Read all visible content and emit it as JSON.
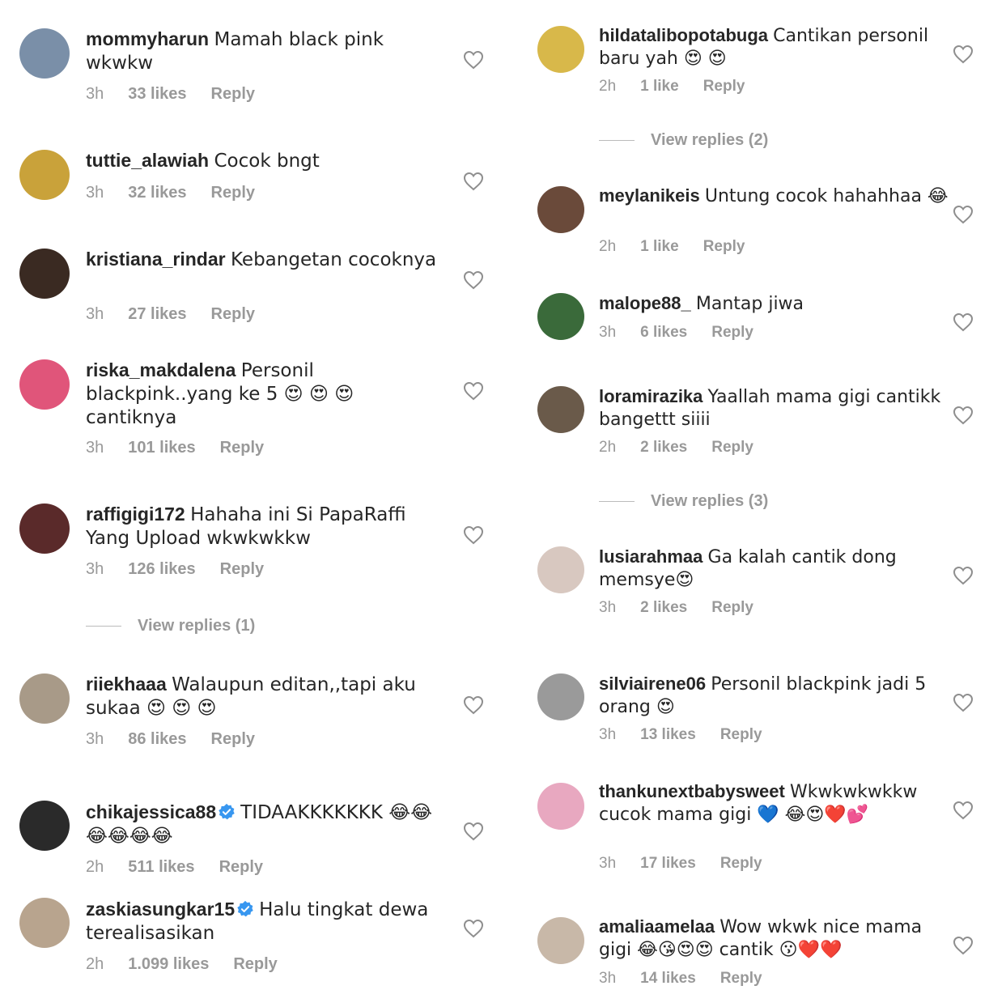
{
  "heart_color": "#8e8e8e",
  "meta_color": "#999999",
  "verified_color": "#3897f0",
  "left": [
    {
      "user": "mommyharun",
      "text": "Mamah black pink wkwkw",
      "time": "3h",
      "likes": "33 likes",
      "reply": "Reply",
      "avatar_color": "#7a8fa8"
    },
    {
      "user": "tuttie_alawiah",
      "text": "Cocok bngt",
      "time": "3h",
      "likes": "32 likes",
      "reply": "Reply",
      "avatar_color": "#c9a23a"
    },
    {
      "user": "kristiana_rindar",
      "text": "Kebangetan cocoknya",
      "time": "3h",
      "likes": "27 likes",
      "reply": "Reply",
      "avatar_color": "#3a2a22"
    },
    {
      "user": "riska_makdalena",
      "text": "Personil blackpink..yang ke 5 😍 😍 😍 cantiknya",
      "time": "3h",
      "likes": "101 likes",
      "reply": "Reply",
      "avatar_color": "#e0557a"
    },
    {
      "user": "raffigigi172",
      "text": "Hahaha ini Si PapaRaffi Yang Upload wkwkwkkw",
      "time": "3h",
      "likes": "126 likes",
      "reply": "Reply",
      "avatar_color": "#5a2a2a",
      "view_replies": "View replies (1)"
    },
    {
      "user": "riiekhaaa",
      "text": "Walaupun editan,,tapi aku sukaa 😍 😍 😍",
      "time": "3h",
      "likes": "86 likes",
      "reply": "Reply",
      "avatar_color": "#a89a88"
    },
    {
      "user": "chikajessica88",
      "text": "TIDAAKKKKKKK 😂😂😂😂😂😂",
      "time": "2h",
      "likes": "511 likes",
      "reply": "Reply",
      "avatar_color": "#2a2a2a",
      "verified": true
    },
    {
      "user": "zaskiasungkar15",
      "text": "Halu tingkat dewa terealisasikan",
      "time": "2h",
      "likes": "1.099 likes",
      "reply": "Reply",
      "avatar_color": "#b8a48e",
      "verified": true
    }
  ],
  "right": [
    {
      "user": "hildatalibopotabuga",
      "text": "Cantikan personil baru yah 😍 😍",
      "time": "2h",
      "likes": "1 like",
      "reply": "Reply",
      "avatar_color": "#d8b84a",
      "view_replies": "View replies (2)"
    },
    {
      "user": "meylanikeis",
      "text": "Untung cocok hahahhaa 😂",
      "time": "2h",
      "likes": "1 like",
      "reply": "Reply",
      "avatar_color": "#6a4a3a"
    },
    {
      "user": "malope88_",
      "text": "Mantap jiwa",
      "time": "3h",
      "likes": "6 likes",
      "reply": "Reply",
      "avatar_color": "#3a6a3a"
    },
    {
      "user": "loramirazika",
      "text": "Yaallah mama gigi cantikk bangettt siiii",
      "time": "2h",
      "likes": "2 likes",
      "reply": "Reply",
      "avatar_color": "#6a5a4a",
      "view_replies": "View replies (3)"
    },
    {
      "user": "lusiarahmaa",
      "text": "Ga kalah cantik dong memsye😍",
      "time": "3h",
      "likes": "2 likes",
      "reply": "Reply",
      "avatar_color": "#d8c8c0"
    },
    {
      "user": "silviairene06",
      "text": "Personil blackpink jadi 5 orang 😍",
      "time": "3h",
      "likes": "13 likes",
      "reply": "Reply",
      "avatar_color": "#9a9a9a"
    },
    {
      "user": "thankunextbabysweet",
      "text": "Wkwkwkwkkw cucok mama gigi 💙 😂😍❤️💕",
      "time": "3h",
      "likes": "17 likes",
      "reply": "Reply",
      "avatar_color": "#e8a8c0"
    },
    {
      "user": "amaliaamelaa",
      "text": "Wow wkwk nice mama gigi 😂😘😍😍 cantik 😗❤️❤️",
      "time": "3h",
      "likes": "14 likes",
      "reply": "Reply",
      "avatar_color": "#c8b8a8"
    }
  ]
}
